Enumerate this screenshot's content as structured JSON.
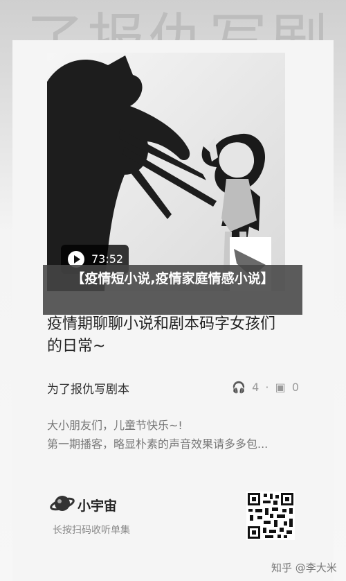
{
  "background": {
    "title": "了报仇写剧"
  },
  "video": {
    "duration": "73:52"
  },
  "overlay": {
    "title": "【疫情短小说,疫情家庭情感小说】"
  },
  "post": {
    "headline": "疫情期聊聊小说和剧本码字女孩们的日常~",
    "author": "为了报仇写剧本",
    "stats": {
      "listens": "4",
      "separator": "·",
      "comments": "0"
    },
    "description_line1": "大小朋友们，儿童节快乐~!",
    "description_line2": "第一期播客，略显朴素的声音效果请多多包..."
  },
  "brand": {
    "name": "小宇宙",
    "tagline": "长按扫码收听单集",
    "icon": "planet-icon"
  },
  "watermark": "知乎 @李大米",
  "colors": {
    "text": "#222222",
    "muted": "#8a8a8a",
    "overlay": "#464646"
  }
}
